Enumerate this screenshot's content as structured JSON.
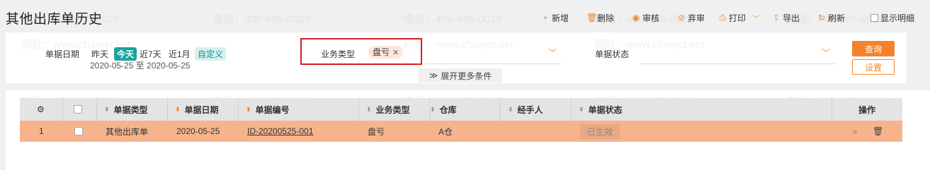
{
  "page": {
    "title": "其他出库单历史"
  },
  "toolbar": {
    "add": "新增",
    "delete": "删除",
    "audit": "审核",
    "unaudit": "弃审",
    "print": "打印",
    "export": "导出",
    "refresh": "刷新",
    "show_detail": "显示明细"
  },
  "filters": {
    "date_label": "单据日期",
    "quick": [
      "昨天",
      "今天",
      "近7天",
      "近1月",
      "自定义"
    ],
    "date_range": "2020-05-25 至 2020-05-25",
    "biz_type_label": "业务类型",
    "biz_type_tag": "盘亏",
    "status_label": "单据状态",
    "expand": "展开更多条件",
    "query_btn": "查询",
    "settings_btn": "设置"
  },
  "watermark": {
    "phone": "电话：400-665-0028",
    "site": "网址：www.chanjet.net"
  },
  "table": {
    "headers": [
      "单据类型",
      "单据日期",
      "单据编号",
      "业务类型",
      "仓库",
      "经手人",
      "单据状态",
      "操作"
    ],
    "rows": [
      {
        "index": "1",
        "type": "其他出库单",
        "date": "2020-05-25",
        "number": "ID-20200525-001",
        "biz_type": "盘亏",
        "warehouse": "A仓",
        "handler": "",
        "status": "已生效"
      }
    ]
  },
  "colors": {
    "accent": "#f5822a",
    "teal": "#1aa3a0",
    "row_highlight": "#f7b48c",
    "annotation_box": "#d42020"
  }
}
